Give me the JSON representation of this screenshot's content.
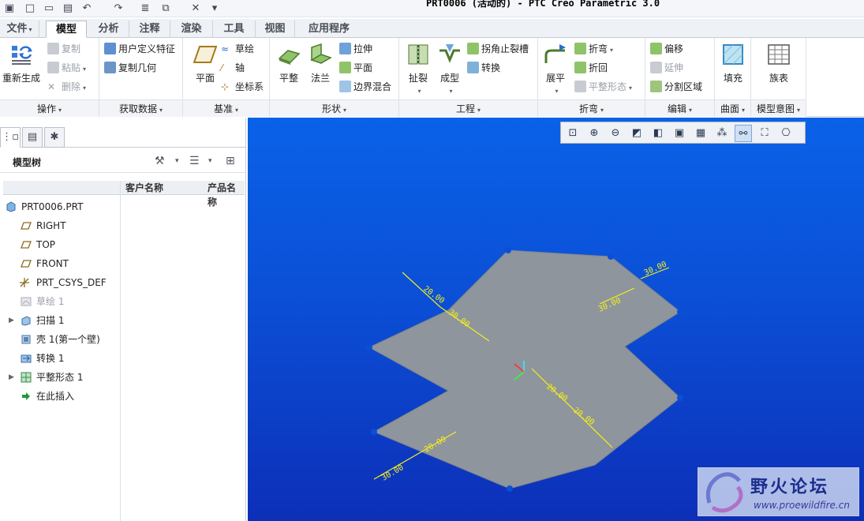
{
  "window": {
    "title": "PRT0006 (活动的) - PTC Creo Parametric 3.0"
  },
  "tabs": {
    "file": "文件",
    "model": "模型",
    "analysis": "分析",
    "annotate": "注释",
    "render": "渲染",
    "tools": "工具",
    "view": "视图",
    "applications": "应用程序"
  },
  "ribbon": {
    "operations": {
      "regenerate": "重新生成",
      "copy": "复制",
      "paste": "粘贴",
      "delete": "删除",
      "label": "操作"
    },
    "get_data": {
      "udf": "用户定义特征",
      "copy_geometry": "复制几何",
      "label": "获取数据"
    },
    "datum": {
      "plane": "平面",
      "sketch": "草绘",
      "axis": "轴",
      "csys": "坐标系",
      "label": "基准"
    },
    "shapes": {
      "planar": "平整",
      "flange": "法兰",
      "extrude": "拉伸",
      "flat": "平面",
      "blend": "边界混合",
      "label": "形状"
    },
    "engineering": {
      "rip": "扯裂",
      "form": "成型",
      "corner_relief": "拐角止裂槽",
      "convert": "转换",
      "label": "工程"
    },
    "bends": {
      "unbend": "展平",
      "bend": "折弯",
      "bend_back": "折回",
      "flat_state": "平整形态",
      "label": "折弯"
    },
    "editing": {
      "offset": "偏移",
      "extend": "延伸",
      "split_area": "分割区域",
      "label": "编辑"
    },
    "surface": {
      "fill": "填充",
      "label": "曲面"
    },
    "model_intent": {
      "family_table": "族表",
      "label": "模型意图"
    }
  },
  "model_tree": {
    "title": "模型树",
    "columns": [
      "客户名称",
      "产品名称"
    ],
    "items": [
      {
        "label": "PRT0006.PRT",
        "icon": "part-icon"
      },
      {
        "label": "RIGHT",
        "icon": "datum-plane-icon"
      },
      {
        "label": "TOP",
        "icon": "datum-plane-icon"
      },
      {
        "label": "FRONT",
        "icon": "datum-plane-icon"
      },
      {
        "label": "PRT_CSYS_DEF",
        "icon": "csys-icon"
      },
      {
        "label": "草绘 1",
        "icon": "sketch-icon"
      },
      {
        "label": "扫描 1",
        "icon": "sweep-icon"
      },
      {
        "label": "壳 1(第一个壁)",
        "icon": "shell-icon"
      },
      {
        "label": "转换 1",
        "icon": "convert-icon"
      },
      {
        "label": "平整形态 1",
        "icon": "flat-state-icon"
      },
      {
        "label": "在此插入",
        "icon": "insert-here-icon"
      }
    ]
  },
  "viewport": {
    "dimensions": [
      "20.00",
      "30.00",
      "20.00",
      "20.00",
      "30.00",
      "30.00",
      "20.00",
      "30.00"
    ],
    "watermark": {
      "title": "野火论坛",
      "url": "www.proewildfire.cn"
    }
  },
  "colors": {
    "viewport_top": "#0a62e8",
    "viewport_bottom": "#0d2fb8",
    "part_gray": "#8e959d",
    "dimension_yellow": "#f5ef1a"
  }
}
